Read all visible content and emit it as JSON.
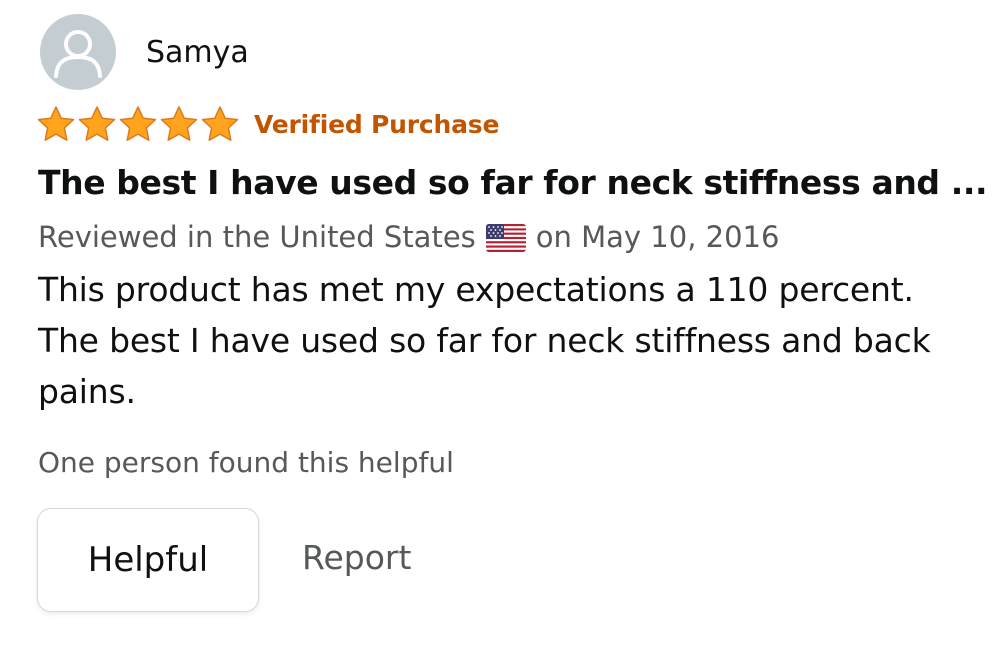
{
  "review": {
    "author": "Samya",
    "rating": 5,
    "rating_max": 5,
    "badge": "Verified Purchase",
    "title": "The best I have used so far for neck stiffness and ...",
    "meta_prefix": "Reviewed in the United States",
    "meta_suffix": "on May 10, 2016",
    "body": "This product has met my expectations a 110 percent. The best I have used so far for neck stiffness and back pains.",
    "helpful_count_text": "One person found this helpful"
  },
  "actions": {
    "helpful_label": "Helpful",
    "report_label": "Report"
  },
  "icons": {
    "avatar": "default-user-avatar-icon",
    "star": "star-icon",
    "flag": "us-flag-icon"
  },
  "colors": {
    "star_fill": "#ffa41c",
    "star_stroke": "#de7921",
    "verified": "#c45500",
    "secondary_text": "#565959",
    "avatar_bg": "#c4cdd2",
    "button_border": "#d5d9d9"
  }
}
